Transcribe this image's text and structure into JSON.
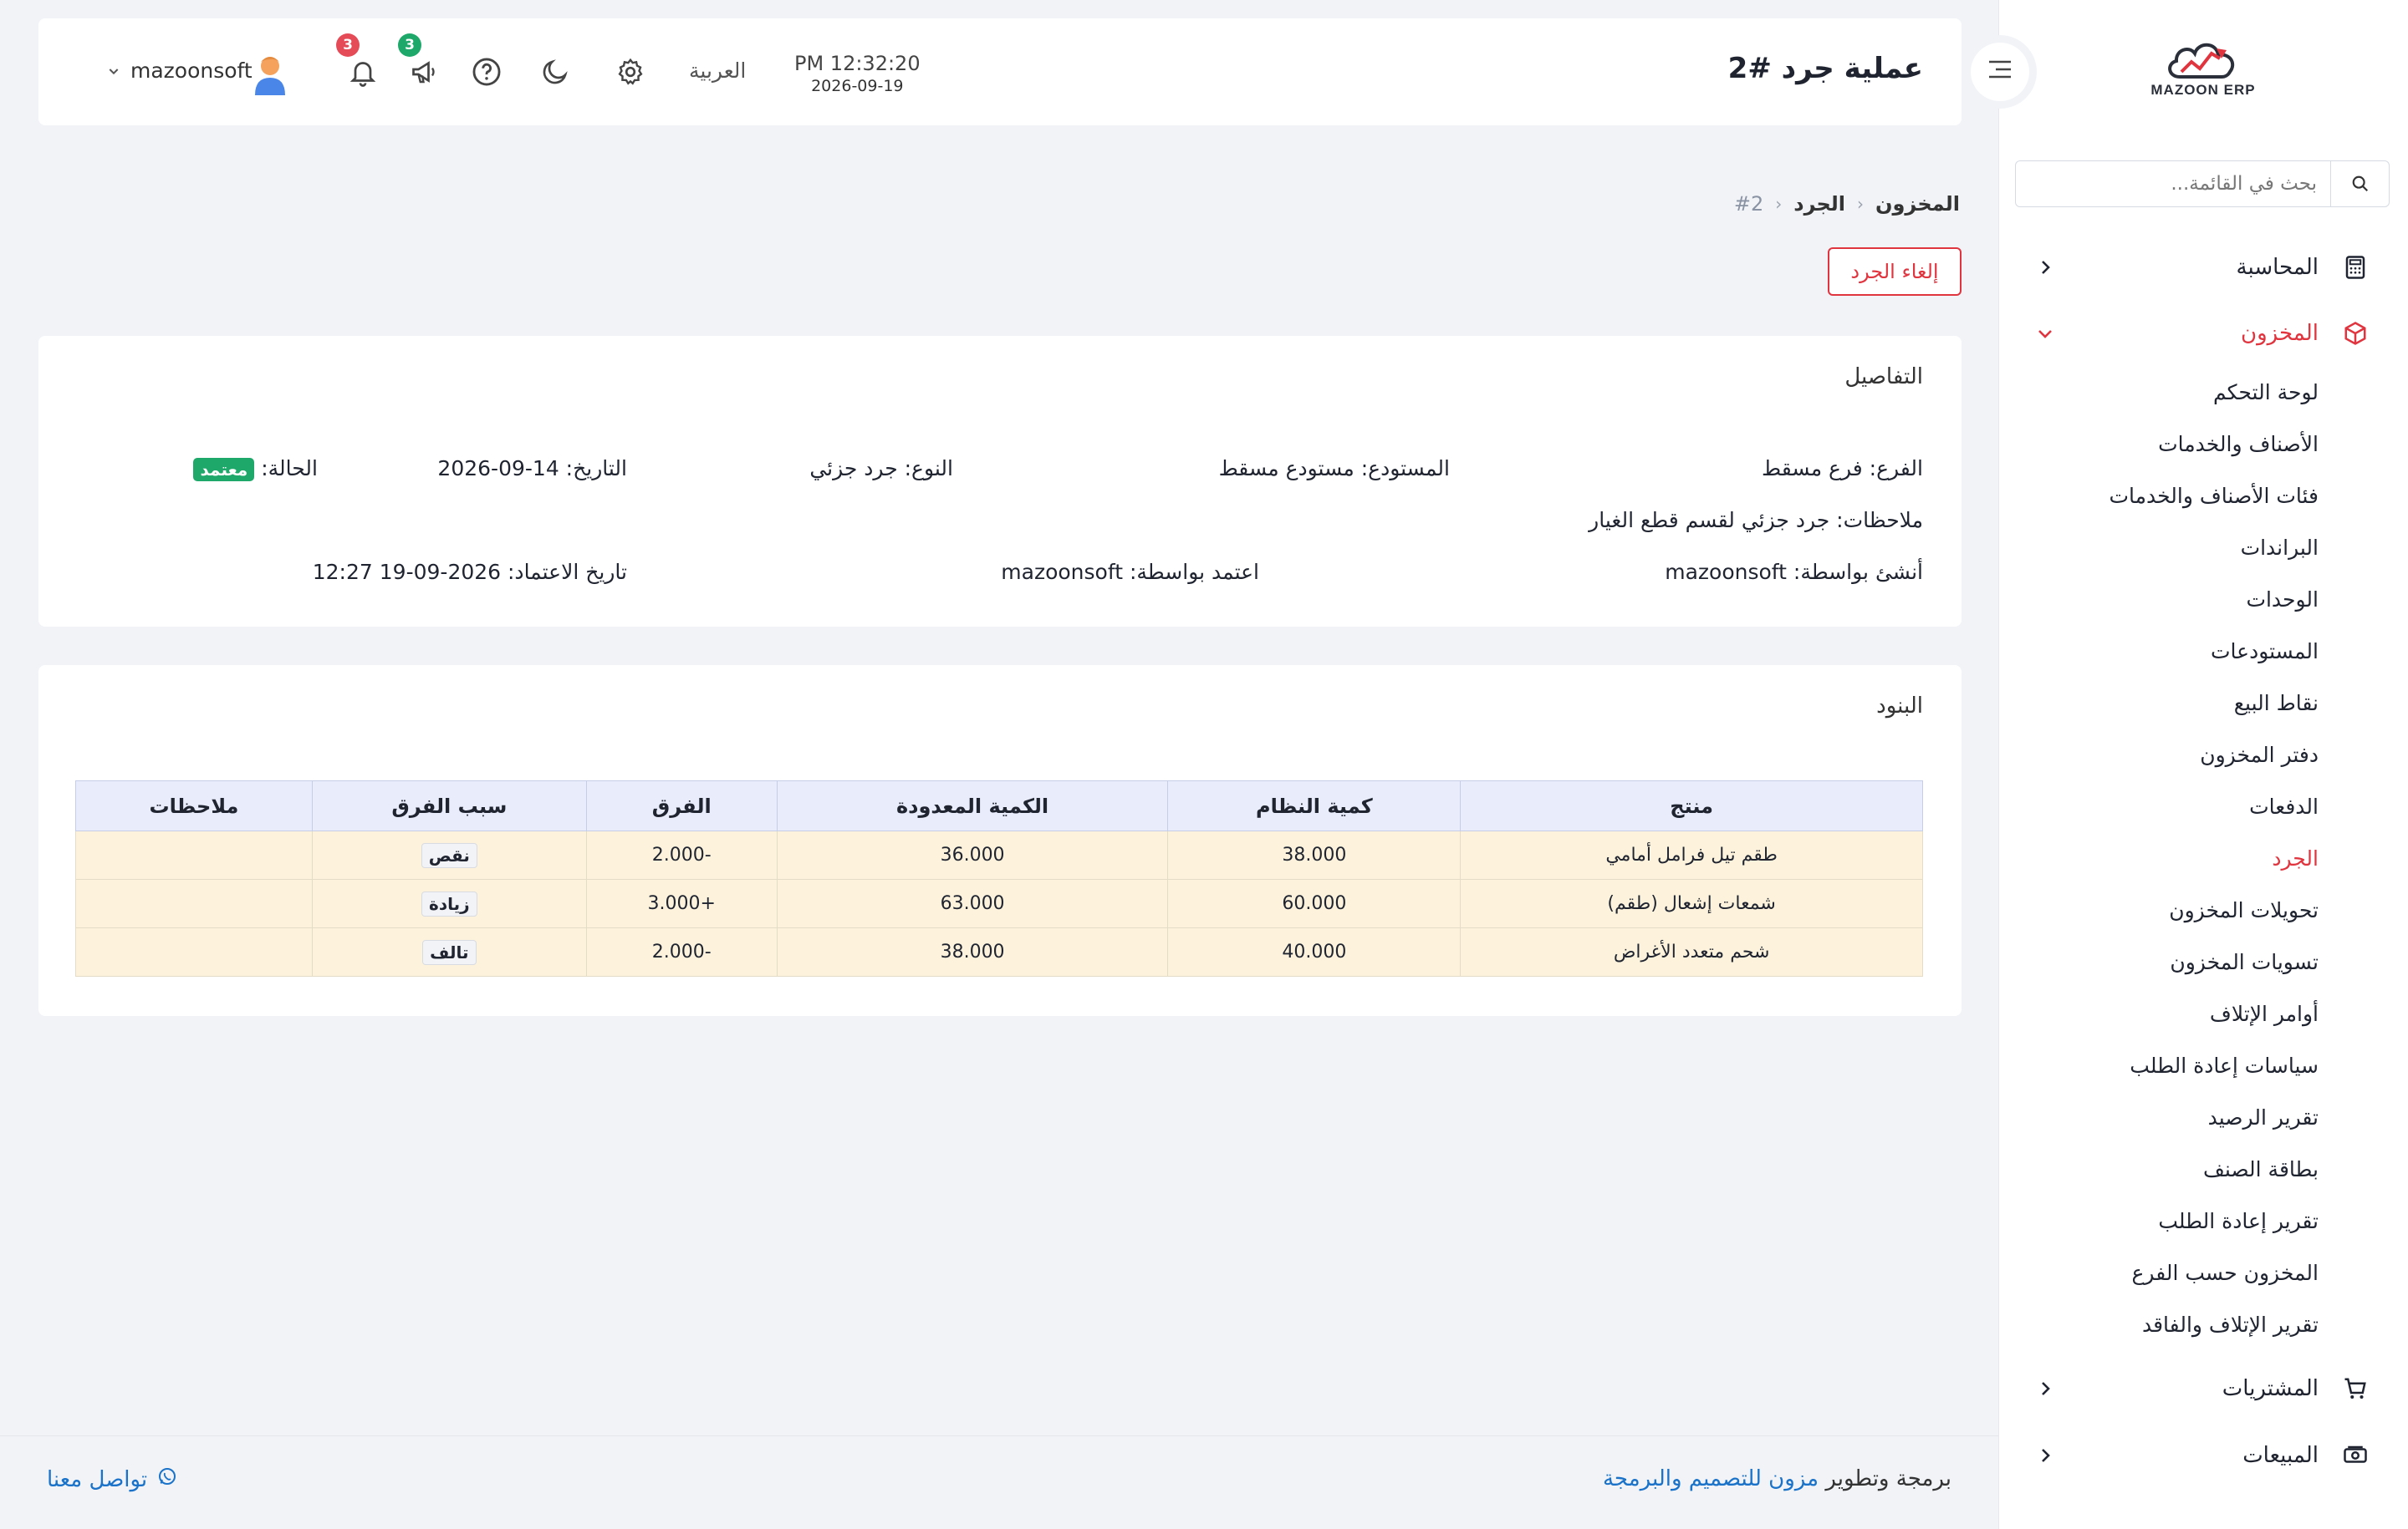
{
  "app": {
    "logo_text": "MAZOON ERP"
  },
  "sidebar": {
    "search_placeholder": "بحث في القائمة...",
    "groups": [
      {
        "label": "المحاسبة",
        "icon": "calculator-icon"
      },
      {
        "label": "المخزون",
        "icon": "box-icon",
        "active": true
      },
      {
        "label": "المشتريات",
        "icon": "cart-icon"
      },
      {
        "label": "المبيعات",
        "icon": "cash-icon"
      }
    ],
    "inventory_items": [
      "لوحة التحكم",
      "الأصناف والخدمات",
      "فئات الأصناف والخدمات",
      "البراندات",
      "الوحدات",
      "المستودعات",
      "نقاط البيع",
      "دفتر المخزون",
      "الدفعات",
      "الجرد",
      "تحويلات المخزون",
      "تسويات المخزون",
      "أوامر الإتلاف",
      "سياسات إعادة الطلب",
      "تقرير الرصيد",
      "بطاقة الصنف",
      "تقرير إعادة الطلب",
      "المخزون حسب الفرع",
      "تقرير الإتلاف والفاقد"
    ],
    "active_item": "الجرد"
  },
  "header": {
    "title": "عملية جرد #2",
    "time": "PM 12:32:20",
    "date": "2026-09-19",
    "language": "العربية",
    "announcements_count": "3",
    "notifications_count": "3",
    "username": "mazoonsoft"
  },
  "breadcrumb": [
    "المخزون",
    "الجرد",
    "#2"
  ],
  "actions": {
    "cancel_label": "إلغاء الجرد"
  },
  "details": {
    "title": "التفاصيل",
    "branch": "الفرع: فرع مسقط",
    "warehouse": "المستودع: مستودع مسقط",
    "type": "النوع: جرد جزئي",
    "date": "التاريخ: 14-09-2026",
    "status_label": "الحالة:",
    "status_value": "معتمد",
    "notes": "ملاحظات: جرد جزئي لقسم قطع الغيار",
    "created_by": "أنشئ بواسطة: mazoonsoft",
    "approved_by": "اعتمد بواسطة: mazoonsoft",
    "approved_at": "تاريخ الاعتماد: 2026-09-19 12:27"
  },
  "items": {
    "title": "البنود",
    "columns": [
      "منتج",
      "كمية النظام",
      "الكمية المعدودة",
      "الفرق",
      "سبب الفرق",
      "ملاحظات"
    ],
    "rows": [
      {
        "product": "طقم تيل فرامل أمامي",
        "system_qty": "38.000",
        "counted_qty": "36.000",
        "diff": "-2.000",
        "reason": "نقص",
        "notes": ""
      },
      {
        "product": "شمعات إشعال (طقم)",
        "system_qty": "60.000",
        "counted_qty": "63.000",
        "diff": "+3.000",
        "reason": "زيادة",
        "notes": ""
      },
      {
        "product": "شحم متعدد الأغراض",
        "system_qty": "40.000",
        "counted_qty": "38.000",
        "diff": "-2.000",
        "reason": "تالف",
        "notes": ""
      }
    ]
  },
  "footer": {
    "credit_prefix": "برمجة وتطوير ",
    "credit_company": "مزون للتصميم والبرمجة",
    "contact": "تواصل معنا"
  },
  "colors": {
    "accent_red": "#e0343f",
    "success_green": "#1ea86a",
    "link_blue": "#1a73c9"
  }
}
